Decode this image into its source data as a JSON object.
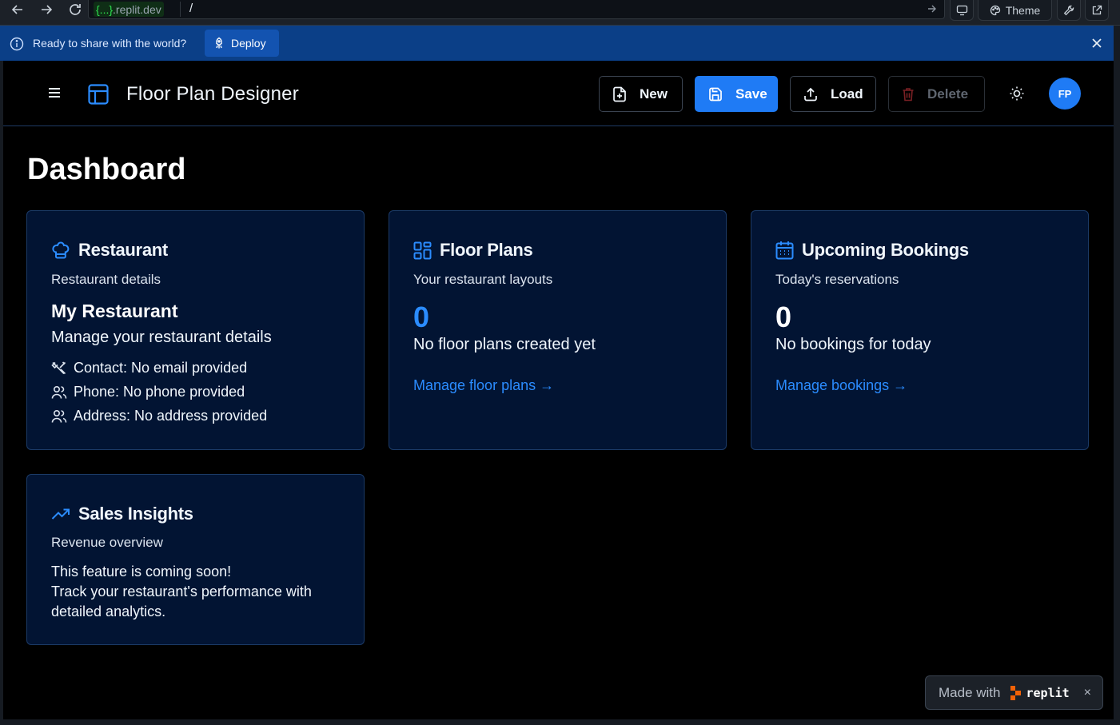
{
  "browser": {
    "url_host_highlight": "{...}",
    "url_host_domain": ".replit.dev",
    "url_path": "/",
    "theme_label": "Theme"
  },
  "banner": {
    "message": "Ready to share with the world?",
    "deploy_label": "Deploy"
  },
  "header": {
    "app_title": "Floor Plan Designer",
    "buttons": {
      "new": "New",
      "save": "Save",
      "load": "Load",
      "delete": "Delete"
    },
    "avatar_initials": "FP"
  },
  "dashboard": {
    "title": "Dashboard",
    "restaurant": {
      "title": "Restaurant",
      "subtitle": "Restaurant details",
      "name": "My Restaurant",
      "description": "Manage your restaurant details",
      "contact": "Contact: No email provided",
      "phone": "Phone: No phone provided",
      "address": "Address: No address provided"
    },
    "floor_plans": {
      "title": "Floor Plans",
      "subtitle": "Your restaurant layouts",
      "count": "0",
      "note": "No floor plans created yet",
      "link": "Manage floor plans →"
    },
    "bookings": {
      "title": "Upcoming Bookings",
      "subtitle": "Today's reservations",
      "count": "0",
      "note": "No bookings for today",
      "link": "Manage bookings →"
    },
    "sales": {
      "title": "Sales Insights",
      "subtitle": "Revenue overview",
      "line1": "This feature is coming soon!",
      "line2": "Track your restaurant's performance with",
      "line3": "detailed analytics."
    }
  },
  "badge": {
    "made_with": "Made with",
    "brand": "replit",
    "close": "×"
  },
  "colors": {
    "accent": "#1f7bf5",
    "banner": "#0b3f87",
    "card_bg": "#021433",
    "app_bg": "#000000"
  }
}
